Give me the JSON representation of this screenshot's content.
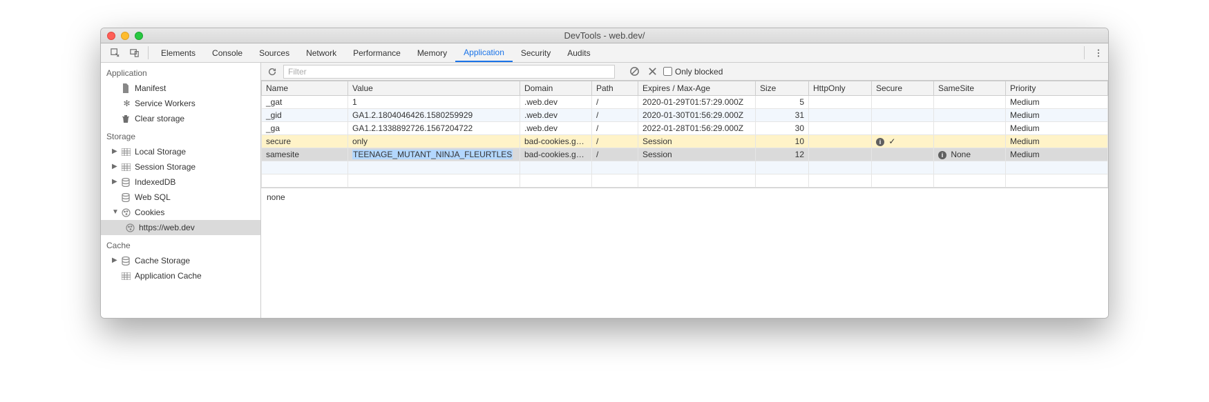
{
  "window": {
    "title": "DevTools - web.dev/"
  },
  "tabs": {
    "items": [
      "Elements",
      "Console",
      "Sources",
      "Network",
      "Performance",
      "Memory",
      "Application",
      "Security",
      "Audits"
    ],
    "active": "Application"
  },
  "sidebar": {
    "section_application": "Application",
    "app_items": {
      "manifest": "Manifest",
      "service_workers": "Service Workers",
      "clear_storage": "Clear storage"
    },
    "section_storage": "Storage",
    "storage_items": {
      "local_storage": "Local Storage",
      "session_storage": "Session Storage",
      "indexeddb": "IndexedDB",
      "websql": "Web SQL",
      "cookies": "Cookies",
      "cookies_child": "https://web.dev"
    },
    "section_cache": "Cache",
    "cache_items": {
      "cache_storage": "Cache Storage",
      "app_cache": "Application Cache"
    }
  },
  "toolbar": {
    "filter_placeholder": "Filter",
    "only_blocked_label": "Only blocked"
  },
  "columns": {
    "name": "Name",
    "value": "Value",
    "domain": "Domain",
    "path": "Path",
    "expires": "Expires / Max-Age",
    "size": "Size",
    "httponly": "HttpOnly",
    "secure": "Secure",
    "samesite": "SameSite",
    "priority": "Priority"
  },
  "rows": [
    {
      "name": "_gat",
      "value": "1",
      "domain": ".web.dev",
      "path": "/",
      "expires": "2020-01-29T01:57:29.000Z",
      "size": "5",
      "httponly": "",
      "secure": "",
      "samesite": "",
      "priority": "Medium",
      "cls": ""
    },
    {
      "name": "_gid",
      "value": "GA1.2.1804046426.1580259929",
      "domain": ".web.dev",
      "path": "/",
      "expires": "2020-01-30T01:56:29.000Z",
      "size": "31",
      "httponly": "",
      "secure": "",
      "samesite": "",
      "priority": "Medium",
      "cls": "alt"
    },
    {
      "name": "_ga",
      "value": "GA1.2.1338892726.1567204722",
      "domain": ".web.dev",
      "path": "/",
      "expires": "2022-01-28T01:56:29.000Z",
      "size": "30",
      "httponly": "",
      "secure": "",
      "samesite": "",
      "priority": "Medium",
      "cls": ""
    },
    {
      "name": "secure",
      "value": "only",
      "domain": "bad-cookies.g…",
      "path": "/",
      "expires": "Session",
      "size": "10",
      "httponly": "",
      "secure": "info-check",
      "samesite": "",
      "priority": "Medium",
      "cls": "warn"
    },
    {
      "name": "samesite",
      "value": "TEENAGE_MUTANT_NINJA_FLEURTLES",
      "domain": "bad-cookies.g…",
      "path": "/",
      "expires": "Session",
      "size": "12",
      "httponly": "",
      "secure": "",
      "samesite": "info-none",
      "priority": "Medium",
      "cls": "sel"
    }
  ],
  "samesite_none_label": "None",
  "detail": "none"
}
